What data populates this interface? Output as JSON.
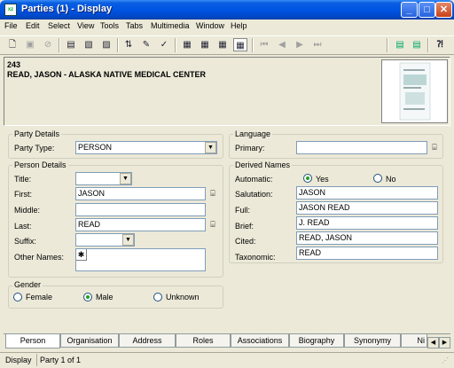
{
  "window": {
    "title": "Parties (1) - Display",
    "app_icon_text": "xz"
  },
  "menu": [
    "File",
    "Edit",
    "Select",
    "View",
    "Tools",
    "Tabs",
    "Multimedia",
    "Window",
    "Help"
  ],
  "header": {
    "id": "243",
    "name": "READ, JASON - ALASKA NATIVE MEDICAL CENTER"
  },
  "party_details": {
    "group": "Party Details",
    "type_label": "Party Type:",
    "type_value": "PERSON"
  },
  "language": {
    "group": "Language",
    "primary_label": "Primary:",
    "primary_value": ""
  },
  "person_details": {
    "group": "Person Details",
    "title_label": "Title:",
    "title_value": "",
    "first_label": "First:",
    "first_value": "JASON",
    "middle_label": "Middle:",
    "middle_value": "",
    "last_label": "Last:",
    "last_value": "READ",
    "suffix_label": "Suffix:",
    "suffix_value": "",
    "other_label": "Other Names:",
    "other_marker": "✱"
  },
  "derived_names": {
    "group": "Derived Names",
    "automatic_label": "Automatic:",
    "yes": "Yes",
    "no": "No",
    "salutation_label": "Salutation:",
    "salutation_value": "JASON",
    "full_label": "Full:",
    "full_value": "JASON READ",
    "brief_label": "Brief:",
    "brief_value": "J. READ",
    "cited_label": "Cited:",
    "cited_value": "READ, JASON",
    "taxonomic_label": "Taxonomic:",
    "taxonomic_value": "READ"
  },
  "gender": {
    "group": "Gender",
    "female": "Female",
    "male": "Male",
    "unknown": "Unknown",
    "selected": "Male"
  },
  "tabs": [
    "Person",
    "Organisation",
    "Address",
    "Roles",
    "Associations",
    "Biography",
    "Synonymy",
    "Ni"
  ],
  "status": {
    "mode": "Display",
    "record": "Party 1 of 1"
  },
  "colors": {
    "title_bar": "#0054E3",
    "window_bg": "#ECE9D8",
    "radio_dot": "#21A121"
  }
}
